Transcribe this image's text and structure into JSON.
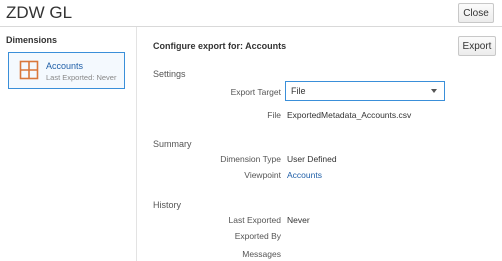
{
  "header": {
    "title": "ZDW GL",
    "close_label": "Close"
  },
  "sidebar": {
    "title": "Dimensions",
    "items": [
      {
        "name": "Accounts",
        "meta": "Last Exported: Never",
        "icon": "grid-icon"
      }
    ]
  },
  "main": {
    "heading": "Configure export for: Accounts",
    "export_label": "Export",
    "settings": {
      "title": "Settings",
      "export_target_label": "Export Target",
      "export_target_value": "File",
      "file_label": "File",
      "file_value": "ExportedMetadata_Accounts.csv"
    },
    "summary": {
      "title": "Summary",
      "dimension_type_label": "Dimension Type",
      "dimension_type_value": "User Defined",
      "viewpoint_label": "Viewpoint",
      "viewpoint_value": "Accounts"
    },
    "history": {
      "title": "History",
      "last_exported_label": "Last Exported",
      "last_exported_value": "Never",
      "exported_by_label": "Exported By",
      "messages_label": "Messages"
    }
  },
  "colors": {
    "accent": "#3a8fd9",
    "link": "#1f5fa8",
    "icon": "#d9773b"
  }
}
